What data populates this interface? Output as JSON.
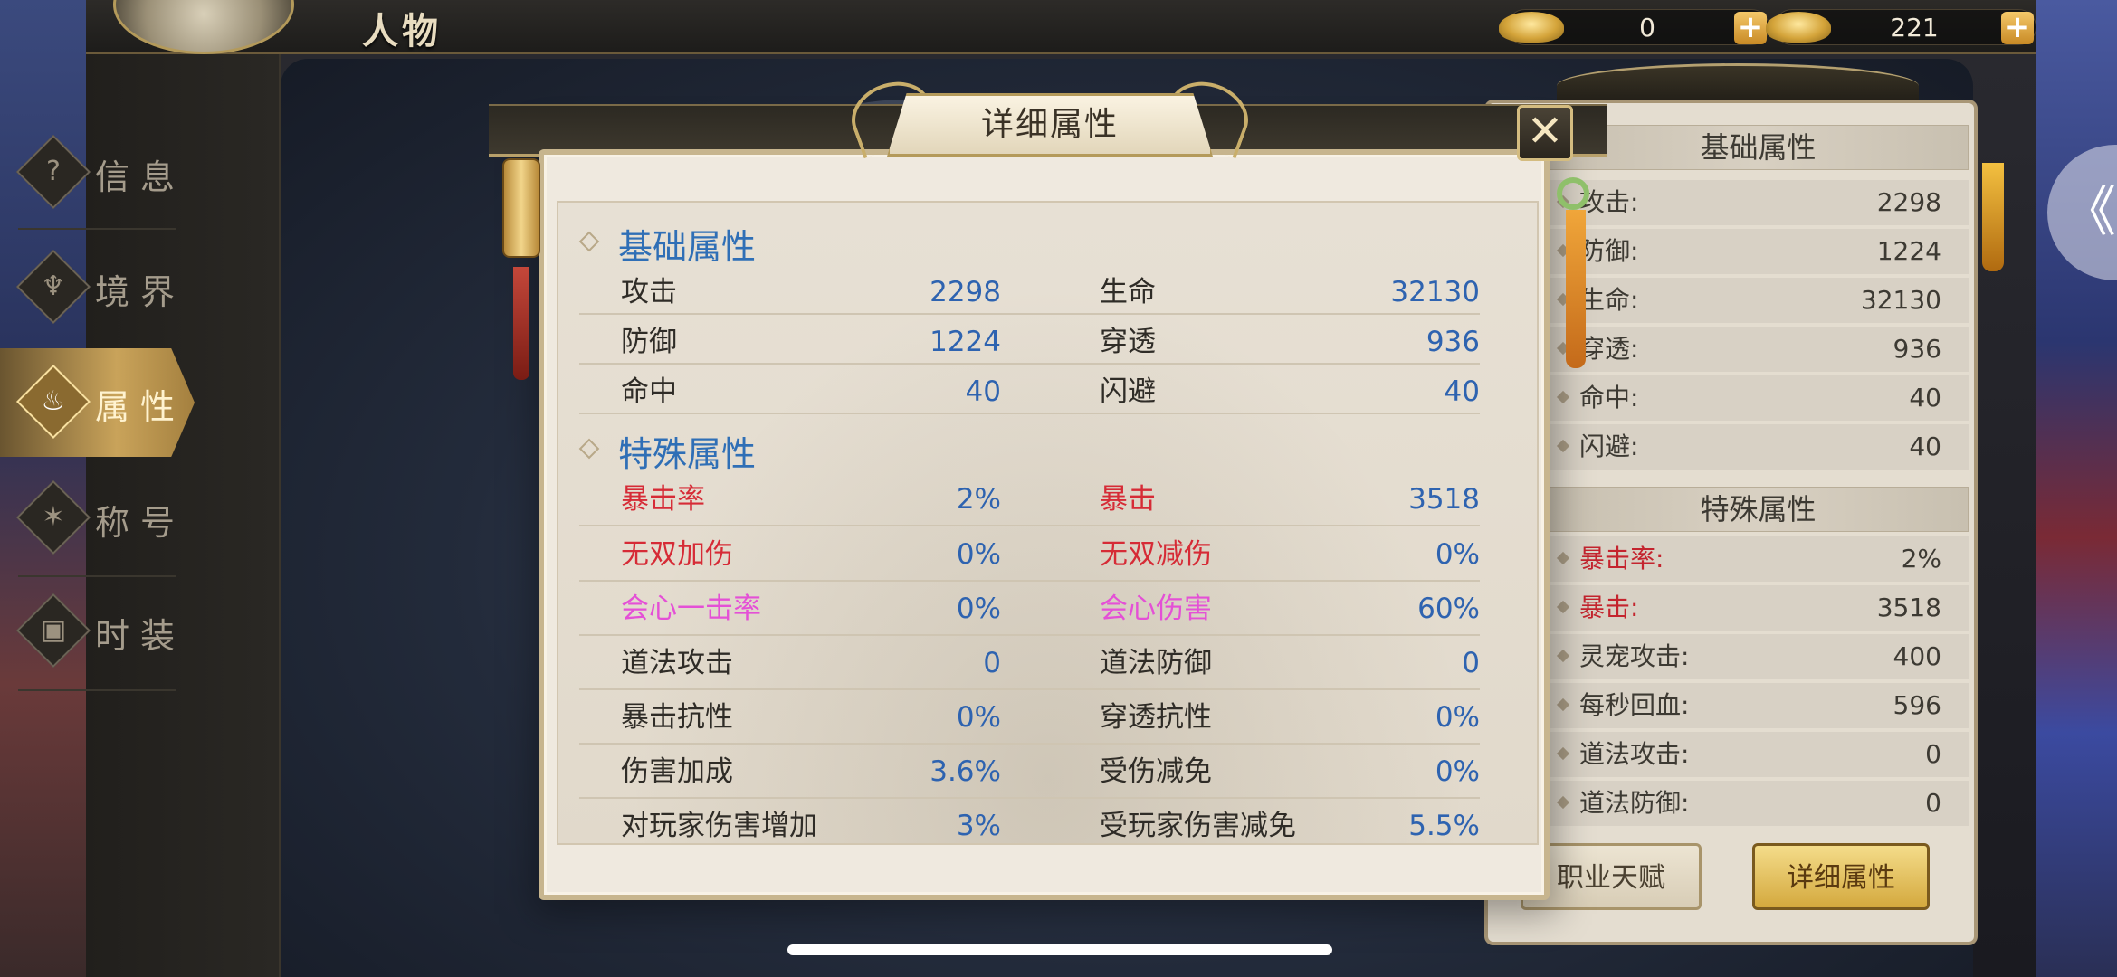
{
  "topbar": {
    "title": "人物",
    "currency_gold": {
      "value": "0",
      "plus": "+"
    },
    "currency_locked": {
      "value": "221",
      "plus": "+"
    }
  },
  "nav": {
    "items": [
      {
        "label": "信息",
        "icon": "question-icon",
        "glyph": "?"
      },
      {
        "label": "境界",
        "icon": "meditation-icon",
        "glyph": "♆"
      },
      {
        "label": "属性",
        "icon": "flame-icon",
        "glyph": "♨",
        "active": true
      },
      {
        "label": "称号",
        "icon": "butterfly-icon",
        "glyph": "✶"
      },
      {
        "label": "时装",
        "icon": "armor-icon",
        "glyph": "▣"
      }
    ]
  },
  "right_panel": {
    "basic_header": "基础属性",
    "basic": [
      {
        "label": "攻击:",
        "value": "2298"
      },
      {
        "label": "防御:",
        "value": "1224"
      },
      {
        "label": "生命:",
        "value": "32130"
      },
      {
        "label": "穿透:",
        "value": "936"
      },
      {
        "label": "命中:",
        "value": "40"
      },
      {
        "label": "闪避:",
        "value": "40"
      }
    ],
    "special_header": "特殊属性",
    "special": [
      {
        "label": "暴击率:",
        "value": "2%",
        "red": true
      },
      {
        "label": "暴击:",
        "value": "3518",
        "red": true
      },
      {
        "label": "灵宠攻击:",
        "value": "400"
      },
      {
        "label": "每秒回血:",
        "value": "596"
      },
      {
        "label": "道法攻击:",
        "value": "0"
      },
      {
        "label": "道法防御:",
        "value": "0"
      }
    ],
    "talent_button": "职业天赋",
    "detail_button": "详细属性"
  },
  "modal": {
    "title": "详细属性",
    "close": "✕",
    "basic_section": "基础属性",
    "basic_rows": [
      [
        {
          "label": "攻击",
          "value": "2298"
        },
        {
          "label": "生命",
          "value": "32130"
        }
      ],
      [
        {
          "label": "防御",
          "value": "1224"
        },
        {
          "label": "穿透",
          "value": "936"
        }
      ],
      [
        {
          "label": "命中",
          "value": "40"
        },
        {
          "label": "闪避",
          "value": "40"
        }
      ]
    ],
    "special_section": "特殊属性",
    "special_rows": [
      [
        {
          "label": "暴击率",
          "value": "2%",
          "color": "red"
        },
        {
          "label": "暴击",
          "value": "3518",
          "color": "red"
        }
      ],
      [
        {
          "label": "无双加伤",
          "value": "0%",
          "color": "red"
        },
        {
          "label": "无双减伤",
          "value": "0%",
          "color": "red"
        }
      ],
      [
        {
          "label": "会心一击率",
          "value": "0%",
          "color": "pink"
        },
        {
          "label": "会心伤害",
          "value": "60%",
          "color": "pink"
        }
      ],
      [
        {
          "label": "道法攻击",
          "value": "0"
        },
        {
          "label": "道法防御",
          "value": "0"
        }
      ],
      [
        {
          "label": "暴击抗性",
          "value": "0%"
        },
        {
          "label": "穿透抗性",
          "value": "0%"
        }
      ],
      [
        {
          "label": "伤害加成",
          "value": "3.6%"
        },
        {
          "label": "受伤减免",
          "value": "0%"
        }
      ],
      [
        {
          "label": "对玩家伤害增加",
          "value": "3%"
        },
        {
          "label": "受玩家伤害减免",
          "value": "5.5%"
        }
      ]
    ]
  },
  "edge_arrow": "《",
  "colors": {
    "section": "#2f6fb6",
    "value": "#2e63b0",
    "red": "#d62b36",
    "pink": "#e450d6",
    "gold": "#c9a35a"
  }
}
